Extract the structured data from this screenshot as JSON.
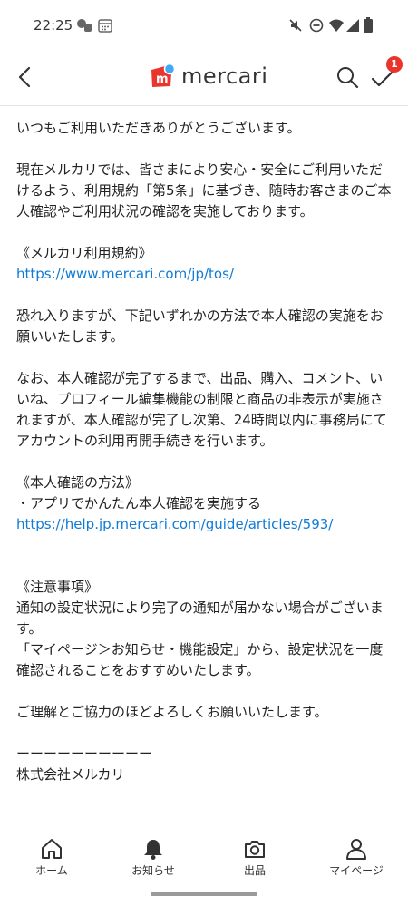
{
  "status_bar": {
    "time": "22:25"
  },
  "header": {
    "logo_text": "mercari",
    "notification_count": "1"
  },
  "content": {
    "p1": "いつもご利用いただきありがとうございます。",
    "p2": "現在メルカリでは、皆さまにより安心・安全にご利用いただけるよう、利用規約「第5条」に基づき、随時お客さまのご本人確認やご利用状況の確認を実施しております。",
    "terms_heading": "《メルカリ利用規約》",
    "terms_link": "https://www.mercari.com/jp/tos/",
    "p3": "恐れ入りますが、下記いずれかの方法で本人確認の実施をお願いいたします。",
    "p4": "なお、本人確認が完了するまで、出品、購入、コメント、いいね、プロフィール編集機能の制限と商品の非表示が実施されますが、本人確認が完了し次第、24時間以内に事務局にてアカウントの利用再開手続きを行います。",
    "method_heading": "《本人確認の方法》",
    "method_item": "・アプリでかんたん本人確認を実施する",
    "method_link": "https://help.jp.mercari.com/guide/articles/593/",
    "notes_heading": "《注意事項》",
    "notes_line1": "通知の設定状況により完了の通知が届かない場合がございます。",
    "notes_line2": "「マイページ＞お知らせ・機能設定」から、設定状況を一度確認されることをおすすめいたします。",
    "closing": "ご理解とご協力のほどよろしくお願いいたします。",
    "separator": "ーーーーーーーーーー",
    "signature": "株式会社メルカリ"
  },
  "bottom_nav": [
    {
      "label": "ホーム",
      "icon": "home-icon"
    },
    {
      "label": "お知らせ",
      "icon": "bell-icon"
    },
    {
      "label": "出品",
      "icon": "camera-icon"
    },
    {
      "label": "マイページ",
      "icon": "person-icon"
    }
  ],
  "colors": {
    "brand_red": "#ea352d",
    "brand_blue": "#3fa9f5",
    "link": "#0f7bd6"
  }
}
